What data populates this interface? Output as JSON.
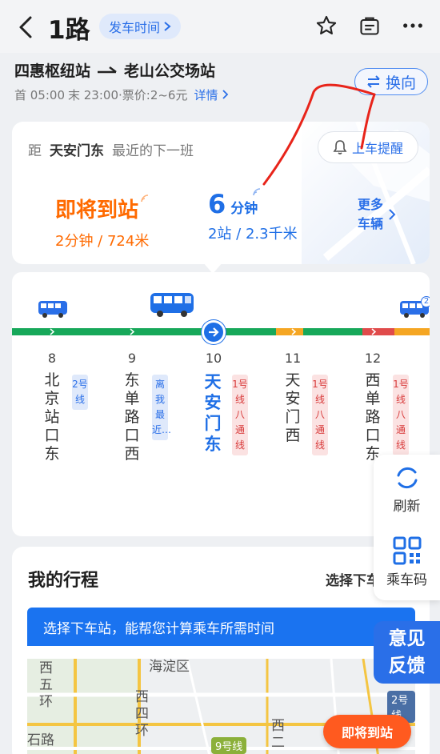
{
  "header": {
    "route_name": "1路",
    "timetable_label": "发车时间",
    "icons": [
      "back-icon",
      "star-icon",
      "bag-icon",
      "more-icon"
    ]
  },
  "route": {
    "from": "四惠枢纽站",
    "to": "老山公交场站",
    "first_bus": "首 05:00",
    "last_bus": "末 23:00",
    "fare": "·票价:2~6元",
    "detail_label": "详情",
    "reverse_label": "换向"
  },
  "realtime": {
    "from_label": "距",
    "station": "天安门东",
    "next_label": "最近的下一班",
    "remind_label": "上车提醒",
    "bus1": {
      "status": "即将到站",
      "info": "2分钟 / 724米"
    },
    "bus2": {
      "minutes": "6",
      "unit": "分钟",
      "info": "2站 / 2.3千米"
    },
    "more_label_1": "更多",
    "more_label_2": "车辆",
    "bus_badge": "2"
  },
  "stations": [
    {
      "num": "8",
      "name": "北京站口东",
      "tag": "2号线",
      "tag_color": "blue"
    },
    {
      "num": "9",
      "name": "东单路口西",
      "tag": "离我最近…",
      "tag_color": "blue"
    },
    {
      "num": "10",
      "name": "天安门东",
      "tag": "1号线八通线",
      "tag_color": "red",
      "current": true
    },
    {
      "num": "11",
      "name": "天安门西",
      "tag": "1号线八通线",
      "tag_color": "red"
    },
    {
      "num": "12",
      "name": "西单路口东",
      "tag": "1号线八通线",
      "tag_color": "red"
    }
  ],
  "side_tools": {
    "refresh": "刷新",
    "qr": "乘车码"
  },
  "feedback": {
    "line1": "意见",
    "line2": "反馈"
  },
  "trip": {
    "title": "我的行程",
    "select_label": "选择下车",
    "tip": "选择下车站，能帮您计算乘车所需时间",
    "arrive_button": "即将到站"
  },
  "map": {
    "district": "海淀区",
    "road1": "西五环",
    "road2": "西四环",
    "road3": "石路",
    "road4": "西二",
    "line9": "9号线",
    "line2": "2号线"
  },
  "colors": {
    "accent": "#1f6fe6",
    "orange": "#ff6a00",
    "track_green": "#17a85a",
    "track_orange": "#f5a623",
    "track_red": "#e04b4b"
  }
}
